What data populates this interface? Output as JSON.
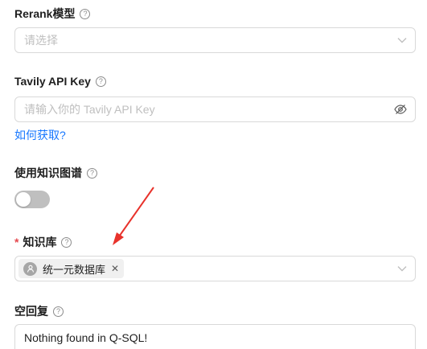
{
  "rerank": {
    "label": "Rerank模型",
    "placeholder": "请选择"
  },
  "tavily": {
    "label": "Tavily API Key",
    "placeholder": "请输入你的 Tavily API Key",
    "help_link": "如何获取?"
  },
  "knowledge_graph": {
    "label": "使用知识图谱",
    "enabled": false
  },
  "knowledge_base": {
    "required_mark": "*",
    "label": "知识库",
    "selected_tags": [
      "统一元数据库"
    ]
  },
  "empty_reply": {
    "label": "空回复",
    "value": "Nothing found in Q-SQL!"
  },
  "colors": {
    "link": "#1677ff",
    "required": "#e5484d",
    "arrow": "#e8322b",
    "switch_off": "#bfbfbf"
  },
  "icons": {
    "help": "question-circle-icon",
    "dropdown": "chevron-down-icon",
    "visibility": "eye-off-icon",
    "avatar": "user-icon",
    "remove": "close-icon"
  }
}
